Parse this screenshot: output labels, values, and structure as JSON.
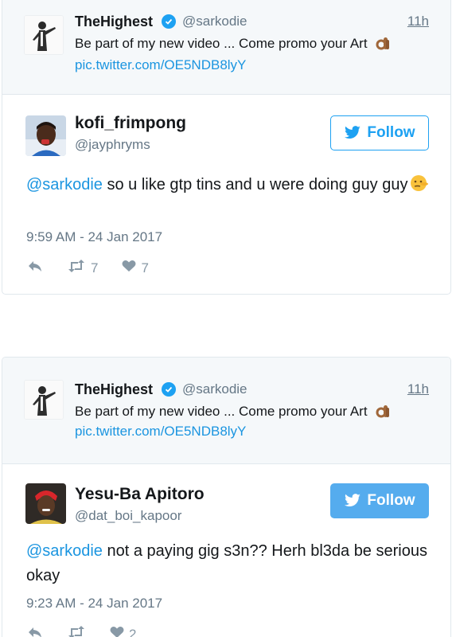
{
  "tweets": [
    {
      "quoted": {
        "name": "TheHighest",
        "handle": "@sarkodie",
        "time": "11h",
        "text": "Be part of my new video ... Come promo your Art",
        "link": "pic.twitter.com/OE5NDB8lyY"
      },
      "reply": {
        "name": "kofi_frimpong",
        "handle": "@jayphryms",
        "follow_label": "Follow",
        "mention": "@sarkodie",
        "text": " so u like gtp tins and u were doing guy guy",
        "datetime": "9:59 AM - 24 Jan 2017",
        "retweets": "7",
        "likes": "7"
      }
    },
    {
      "quoted": {
        "name": "TheHighest",
        "handle": "@sarkodie",
        "time": "11h",
        "text": "Be part of my new video ... Come promo your Art",
        "link": "pic.twitter.com/OE5NDB8lyY"
      },
      "reply": {
        "name": "Yesu-Ba Apitoro",
        "handle": "@dat_boi_kapoor",
        "follow_label": "Follow",
        "mention": "@sarkodie",
        "text": " not a paying gig s3n?? Herh bl3da be serious okay",
        "datetime": "9:23 AM - 24 Jan 2017",
        "likes": "2"
      }
    }
  ],
  "colors": {
    "accent": "#1da1f2",
    "link": "#1b95e0",
    "muted": "#657786",
    "quoted_bg": "#f5f8fa"
  },
  "icons": [
    "verified-badge-icon",
    "ok-hand-emoji-icon",
    "twitter-bird-icon",
    "reply-icon",
    "retweet-icon",
    "heart-icon",
    "lying-face-emoji-icon"
  ]
}
